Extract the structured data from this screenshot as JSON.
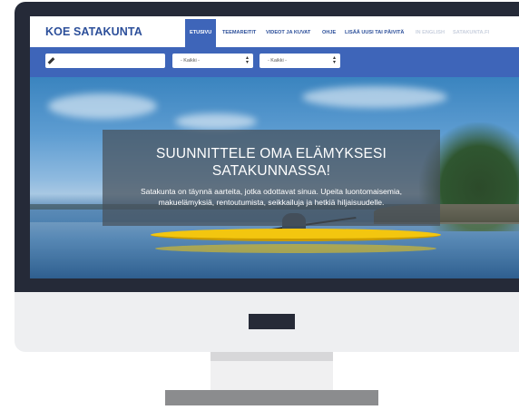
{
  "site": {
    "logo": "KOE SATAKUNTA"
  },
  "nav": {
    "items": [
      {
        "label": "ETUSIVU",
        "state": "active"
      },
      {
        "label": "TEEMAREITIT",
        "state": "normal"
      },
      {
        "label": "VIDEOT JA KUVAT",
        "state": "normal"
      },
      {
        "label": "OHJE",
        "state": "normal"
      },
      {
        "label": "LISÄÄ UUSI TAI PÄIVITÄ",
        "state": "normal"
      },
      {
        "label": "IN ENGLISH",
        "state": "muted"
      },
      {
        "label": "SATAKUNTA.FI",
        "state": "muted"
      }
    ]
  },
  "search": {
    "text_value": "",
    "text_icon": "pencil-icon",
    "select1": "- Kaikki -",
    "select2": "- Kaikki -"
  },
  "hero": {
    "headline_line1": "SUUNNITTELE OMA ELÄMYKSESI",
    "headline_line2": "SATAKUNNASSA!",
    "lead_line1": "Satakunta on täynnä aarteita, jotka odottavat sinua. Upeita luontomaisemia,",
    "lead_line2": "makuelämyksiä, rentoutumista, seikkailuja ja hetkiä hiljaisuudelle."
  },
  "colors": {
    "brand_blue": "#3e65b9",
    "logo_blue": "#2c4f9a",
    "monitor_dark": "#252a38"
  }
}
